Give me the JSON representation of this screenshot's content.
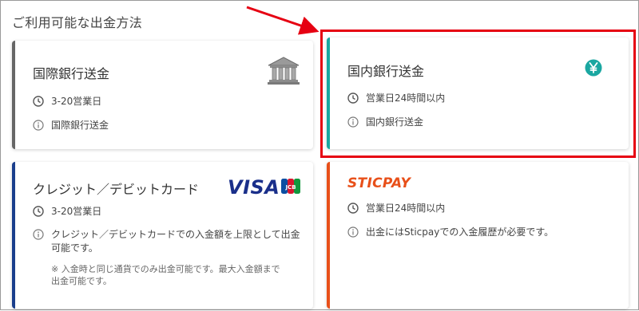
{
  "page": {
    "section_title": "ご利用可能な出金方法"
  },
  "cards": {
    "intl": {
      "title": "国際銀行送金",
      "duration": "3-20営業日",
      "info": "国際銀行送金",
      "icon": "bank-icon",
      "accent": "#666666"
    },
    "domestic": {
      "title": "国内銀行送金",
      "duration": "営業日24時間以内",
      "info": "国内銀行送金",
      "icon": "yen-icon",
      "accent": "#1aa7a1"
    },
    "card": {
      "title": "クレジット／デビットカード",
      "duration": "3-20営業日",
      "info_line1": "クレジット／デビットカードでの入金額を上限として出金",
      "info_line2": "可能です。",
      "note_line1": "※ 入金時と同じ通貨でのみ出金可能です。最大入金額まで",
      "note_line2": "出金可能です。",
      "visa_logo": "VISA",
      "jcb_logo": "JCB",
      "accent": "#1a3e8c"
    },
    "sticpay": {
      "logo": "STICPAY",
      "duration": "営業日24時間以内",
      "info": "出金にはSticpayでの入金履歴が必要です。",
      "accent": "#e8501a"
    }
  },
  "annotation": {
    "highlight_color": "#e60012",
    "arrow_color": "#e60012"
  }
}
